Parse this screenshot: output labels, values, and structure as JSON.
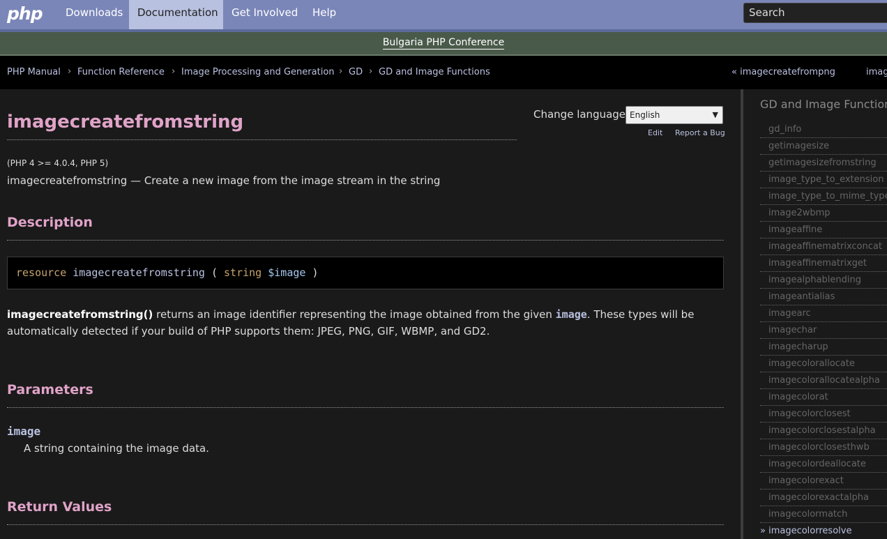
{
  "nav": {
    "logo": "php",
    "items": [
      "Downloads",
      "Documentation",
      "Get Involved",
      "Help"
    ],
    "active": "Documentation",
    "search_placeholder": "Search"
  },
  "conference": {
    "text": "Bulgaria PHP Conference"
  },
  "breadcrumb": [
    "PHP Manual",
    "Function Reference",
    "Image Processing and Generation",
    "GD",
    "GD and Image Functions"
  ],
  "pager": {
    "prev": "« imagecreatefrompng",
    "next": "imag"
  },
  "page": {
    "title": "imagecreatefromstring",
    "change_language_label": "Change language:",
    "language_selected": "English",
    "edit_label": "Edit",
    "report_bug_label": "Report a Bug",
    "versions": "(PHP 4 >= 4.0.4, PHP 5)",
    "refpurpose": "imagecreatefromstring — Create a new image from the image stream in the string",
    "description_heading": "Description",
    "signature": {
      "return_type": "resource",
      "name": "imagecreatefromstring",
      "open": "(",
      "param_type": "string",
      "param_name": "$image",
      "close": ")"
    },
    "desc_func": "imagecreatefromstring()",
    "desc_part1": " returns an image identifier representing the image obtained from the given ",
    "desc_param": "image",
    "desc_part2": ". These types will be automatically detected if your build of PHP supports them: JPEG, PNG, GIF, WBMP, and GD2.",
    "parameters_heading": "Parameters",
    "param_name": "image",
    "param_desc": "A string containing the image data.",
    "return_heading": "Return Values"
  },
  "sidebar": {
    "title": "GD and Image Functions",
    "items": [
      "gd_info",
      "getimagesize",
      "getimagesizefromstring",
      "image_type_to_extension",
      "image_type_to_mime_type",
      "image2wbmp",
      "imageaffine",
      "imageaffinematrixconcat",
      "imageaffinematrixget",
      "imagealphablending",
      "imageantialias",
      "imagearc",
      "imagechar",
      "imagecharup",
      "imagecolorallocate",
      "imagecolorallocatealpha",
      "imagecolorat",
      "imagecolorclosest",
      "imagecolorclosestalpha",
      "imagecolorclosesthwb",
      "imagecolordeallocate",
      "imagecolorexact",
      "imagecolorexactalpha",
      "imagecolormatch"
    ],
    "current": "» imagecolorresolve"
  }
}
